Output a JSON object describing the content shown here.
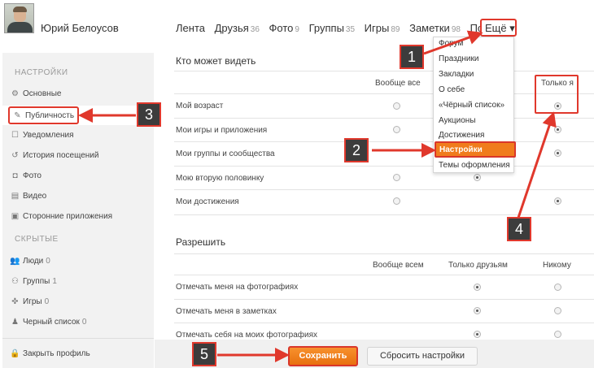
{
  "user": {
    "name": "Юрий Белоусов"
  },
  "topnav": {
    "items": [
      {
        "label": "Лента",
        "count": ""
      },
      {
        "label": "Друзья",
        "count": "36"
      },
      {
        "label": "Фото",
        "count": "9"
      },
      {
        "label": "Группы",
        "count": "35"
      },
      {
        "label": "Игры",
        "count": "89"
      },
      {
        "label": "Заметки",
        "count": "98"
      },
      {
        "label": "Подарк",
        "count": ""
      }
    ],
    "more_label": "Ещё ▾"
  },
  "sidebar": {
    "settings_head": "НАСТРОЙКИ",
    "items": [
      {
        "icon": "gear-icon",
        "glyph": "⚙",
        "label": "Основные"
      },
      {
        "icon": "brush-icon",
        "glyph": "✎",
        "label": "Публичность"
      },
      {
        "icon": "notification-icon",
        "glyph": "☐",
        "label": "Уведомления"
      },
      {
        "icon": "history-icon",
        "glyph": "↺",
        "label": "История посещений"
      },
      {
        "icon": "camera-icon",
        "glyph": "◘",
        "label": "Фото"
      },
      {
        "icon": "film-icon",
        "glyph": "▤",
        "label": "Видео"
      },
      {
        "icon": "apps-icon",
        "glyph": "▣",
        "label": "Сторонние приложения"
      }
    ],
    "hidden_head": "СКРЫТЫЕ",
    "hidden_items": [
      {
        "icon": "people-icon",
        "glyph": "👥",
        "label": "Люди",
        "count": "0"
      },
      {
        "icon": "groups-icon",
        "glyph": "⚇",
        "label": "Группы",
        "count": "1"
      },
      {
        "icon": "gamepad-icon",
        "glyph": "✜",
        "label": "Игры",
        "count": "0"
      },
      {
        "icon": "blacklist-icon",
        "glyph": "♟",
        "label": "Черный список",
        "count": "0"
      }
    ],
    "close_profile": {
      "icon": "lock-icon",
      "glyph": "🔒",
      "label": "Закрыть профиль"
    }
  },
  "who_can_see": {
    "title": "Кто может видеть",
    "col_all": "Вообще все",
    "col_only_me": "Только я",
    "rows": [
      {
        "label": "Мой возраст",
        "selected": "only_me"
      },
      {
        "label": "Мои игры и приложения",
        "selected": "only_me"
      },
      {
        "label": "Мои группы и сообщества",
        "selected": "only_me"
      },
      {
        "label": "Мою вторую половинку",
        "selected": "friends"
      },
      {
        "label": "Мои достижения",
        "selected": "only_me"
      }
    ]
  },
  "allow": {
    "title": "Разрешить",
    "col_all": "Вообще всем",
    "col_friends": "Только друзьям",
    "col_none": "Никому",
    "rows": [
      {
        "label": "Отмечать меня на фотографиях",
        "selected": "friends"
      },
      {
        "label": "Отмечать меня в заметках",
        "selected": "friends"
      },
      {
        "label": "Отмечать себя на моих фотографиях",
        "selected": "friends"
      }
    ]
  },
  "dropdown": {
    "items": [
      "Форум",
      "Праздники",
      "Закладки",
      "О себе",
      "«Чёрный список»",
      "Аукционы",
      "Достижения",
      "Настройки",
      "Темы оформления"
    ],
    "selected": "Настройки"
  },
  "buttons": {
    "save": "Сохранить",
    "reset": "Сбросить настройки"
  },
  "callouts": [
    "1",
    "2",
    "3",
    "4",
    "5"
  ],
  "colors": {
    "accent_red": "#e0382c",
    "orange": "#f07c1c",
    "callout_bg": "#3c3c3c"
  }
}
